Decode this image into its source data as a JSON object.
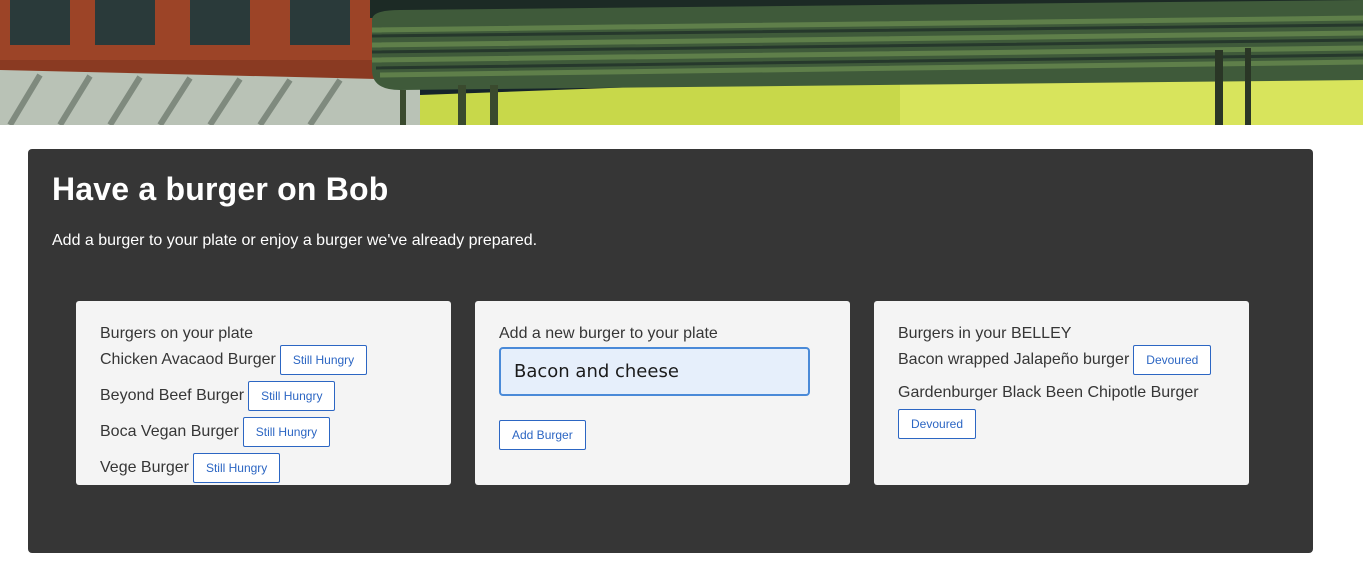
{
  "banner": {
    "icon": "building-illustration"
  },
  "jumbotron": {
    "title": "Have a burger on Bob",
    "subtitle": "Add a burger to your plate or enjoy a burger we've already prepared."
  },
  "plate": {
    "heading": "Burgers on your plate",
    "items": [
      {
        "name": "Chicken Avacaod Burger",
        "action": "Still Hungry"
      },
      {
        "name": "Beyond Beef Burger",
        "action": "Still Hungry"
      },
      {
        "name": "Boca Vegan Burger",
        "action": "Still Hungry"
      },
      {
        "name": "Vege Burger",
        "action": "Still Hungry"
      }
    ]
  },
  "add_form": {
    "heading": "Add a new burger to your plate",
    "input_value": "Bacon and cheese",
    "submit_label": "Add Burger"
  },
  "belly": {
    "heading": "Burgers in your BELLEY",
    "items": [
      {
        "name": "Bacon wrapped Jalapeño burger",
        "action": "Devoured"
      },
      {
        "name": "Gardenburger Black Been Chipotle Burger",
        "action": "Devoured"
      }
    ]
  },
  "colors": {
    "panel_bg": "#363636",
    "card_bg": "#f4f4f4",
    "button_accent": "#2c66c3",
    "input_focus_border": "#4a8ad8"
  }
}
